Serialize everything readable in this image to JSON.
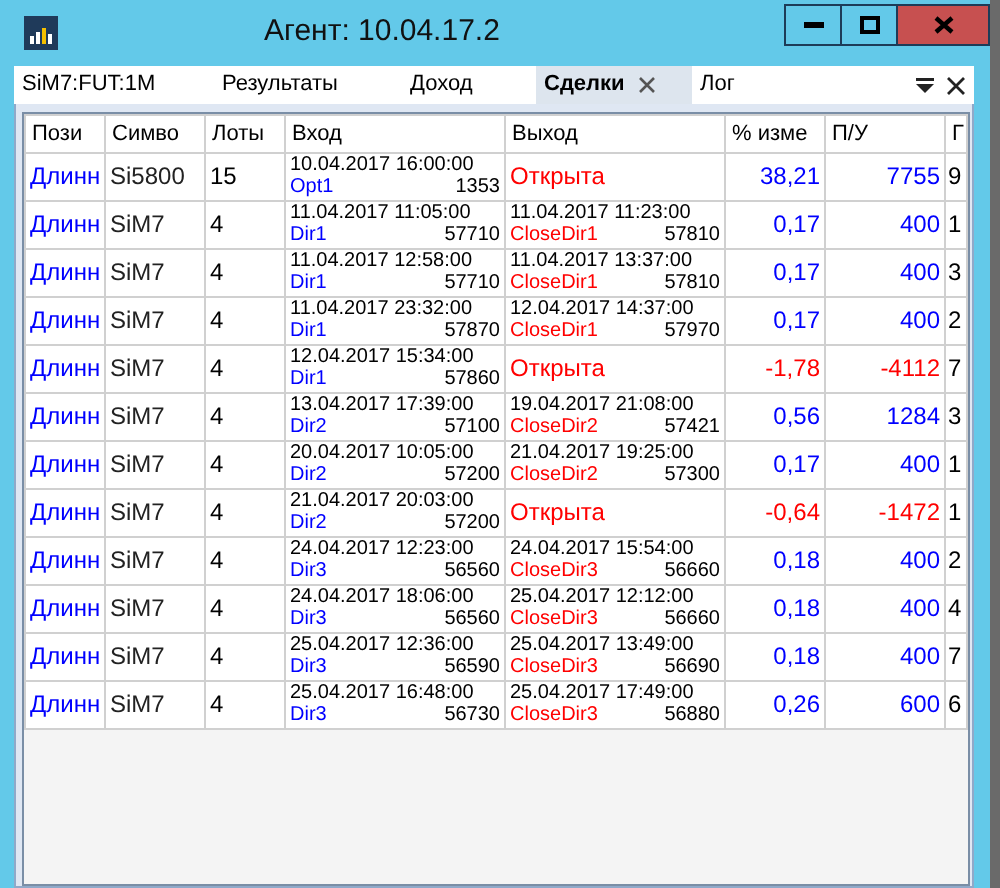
{
  "window": {
    "title": "Агент: 10.04.17.2"
  },
  "tabs": [
    {
      "label": "SiM7:FUT:1M",
      "selected": false
    },
    {
      "label": "Результаты",
      "selected": false
    },
    {
      "label": "Доход",
      "selected": false
    },
    {
      "label": "Сделки",
      "selected": true,
      "closable": true
    },
    {
      "label": "Лог",
      "selected": false
    }
  ],
  "table": {
    "columns": [
      "Пози",
      "Симво",
      "Лоты",
      "Вход",
      "Выход",
      "% изме",
      "П/У",
      "Г"
    ],
    "rows": [
      {
        "position": "Длинн",
        "symbol": "Si5800",
        "lots": "15",
        "entry": {
          "time": "10.04.2017 16:00:00",
          "signal": "Opt1",
          "price": "1353"
        },
        "exit": {
          "kind": "open",
          "status": "Открыта"
        },
        "change": "38,21",
        "profit": "7755",
        "loss": false,
        "column_8": "9"
      },
      {
        "position": "Длинн",
        "symbol": "SiM7",
        "lots": "4",
        "entry": {
          "time": "11.04.2017 11:05:00",
          "signal": "Dir1",
          "price": "57710"
        },
        "exit": {
          "kind": "closed",
          "time": "11.04.2017 11:23:00",
          "signal": "CloseDir1",
          "price": "57810"
        },
        "change": "0,17",
        "profit": "400",
        "loss": false,
        "column_8": "1"
      },
      {
        "position": "Длинн",
        "symbol": "SiM7",
        "lots": "4",
        "entry": {
          "time": "11.04.2017 12:58:00",
          "signal": "Dir1",
          "price": "57710"
        },
        "exit": {
          "kind": "closed",
          "time": "11.04.2017 13:37:00",
          "signal": "CloseDir1",
          "price": "57810"
        },
        "change": "0,17",
        "profit": "400",
        "loss": false,
        "column_8": "3"
      },
      {
        "position": "Длинн",
        "symbol": "SiM7",
        "lots": "4",
        "entry": {
          "time": "11.04.2017 23:32:00",
          "signal": "Dir1",
          "price": "57870"
        },
        "exit": {
          "kind": "closed",
          "time": "12.04.2017 14:37:00",
          "signal": "CloseDir1",
          "price": "57970"
        },
        "change": "0,17",
        "profit": "400",
        "loss": false,
        "column_8": "2"
      },
      {
        "position": "Длинн",
        "symbol": "SiM7",
        "lots": "4",
        "entry": {
          "time": "12.04.2017 15:34:00",
          "signal": "Dir1",
          "price": "57860"
        },
        "exit": {
          "kind": "open",
          "status": "Открыта"
        },
        "change": "-1,78",
        "profit": "-4112",
        "loss": true,
        "column_8": "7"
      },
      {
        "position": "Длинн",
        "symbol": "SiM7",
        "lots": "4",
        "entry": {
          "time": "13.04.2017 17:39:00",
          "signal": "Dir2",
          "price": "57100"
        },
        "exit": {
          "kind": "closed",
          "time": "19.04.2017 21:08:00",
          "signal": "CloseDir2",
          "price": "57421"
        },
        "change": "0,56",
        "profit": "1284",
        "loss": false,
        "column_8": "3"
      },
      {
        "position": "Длинн",
        "symbol": "SiM7",
        "lots": "4",
        "entry": {
          "time": "20.04.2017 10:05:00",
          "signal": "Dir2",
          "price": "57200"
        },
        "exit": {
          "kind": "closed",
          "time": "21.04.2017 19:25:00",
          "signal": "CloseDir2",
          "price": "57300"
        },
        "change": "0,17",
        "profit": "400",
        "loss": false,
        "column_8": "1"
      },
      {
        "position": "Длинн",
        "symbol": "SiM7",
        "lots": "4",
        "entry": {
          "time": "21.04.2017 20:03:00",
          "signal": "Dir2",
          "price": "57200"
        },
        "exit": {
          "kind": "open",
          "status": "Открыта"
        },
        "change": "-0,64",
        "profit": "-1472",
        "loss": true,
        "column_8": "1"
      },
      {
        "position": "Длинн",
        "symbol": "SiM7",
        "lots": "4",
        "entry": {
          "time": "24.04.2017 12:23:00",
          "signal": "Dir3",
          "price": "56560"
        },
        "exit": {
          "kind": "closed",
          "time": "24.04.2017 15:54:00",
          "signal": "CloseDir3",
          "price": "56660"
        },
        "change": "0,18",
        "profit": "400",
        "loss": false,
        "column_8": "2"
      },
      {
        "position": "Длинн",
        "symbol": "SiM7",
        "lots": "4",
        "entry": {
          "time": "24.04.2017 18:06:00",
          "signal": "Dir3",
          "price": "56560"
        },
        "exit": {
          "kind": "closed",
          "time": "25.04.2017 12:12:00",
          "signal": "CloseDir3",
          "price": "56660"
        },
        "change": "0,18",
        "profit": "400",
        "loss": false,
        "column_8": "4"
      },
      {
        "position": "Длинн",
        "symbol": "SiM7",
        "lots": "4",
        "entry": {
          "time": "25.04.2017 12:36:00",
          "signal": "Dir3",
          "price": "56590"
        },
        "exit": {
          "kind": "closed",
          "time": "25.04.2017 13:49:00",
          "signal": "CloseDir3",
          "price": "56690"
        },
        "change": "0,18",
        "profit": "400",
        "loss": false,
        "column_8": "7"
      },
      {
        "position": "Длинн",
        "symbol": "SiM7",
        "lots": "4",
        "entry": {
          "time": "25.04.2017 16:48:00",
          "signal": "Dir3",
          "price": "56730"
        },
        "exit": {
          "kind": "closed",
          "time": "25.04.2017 17:49:00",
          "signal": "CloseDir3",
          "price": "56880"
        },
        "change": "0,26",
        "profit": "600",
        "loss": false,
        "column_8": "6"
      }
    ]
  }
}
